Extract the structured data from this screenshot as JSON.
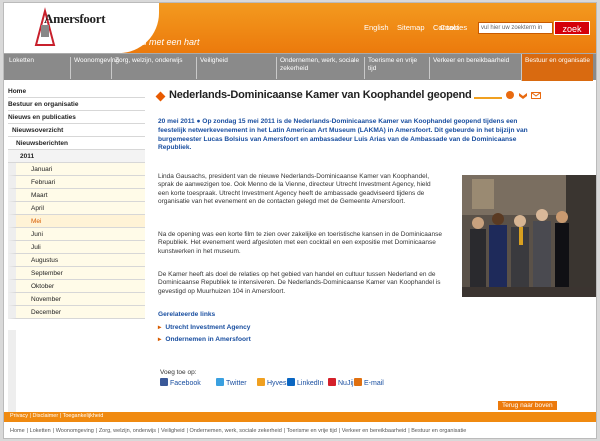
{
  "header": {
    "logo_text": "Amersfoort",
    "tagline": "Stad met een hart",
    "links": [
      "English",
      "Sitemap",
      "Contact",
      "Cookies"
    ],
    "search_placeholder": "vul hier uw zoekterm in",
    "search_button": "zoek"
  },
  "nav": [
    {
      "label": "Loketten"
    },
    {
      "label": "Woonomgeving"
    },
    {
      "label": "Zorg, welzijn, onderwijs"
    },
    {
      "label": "Veiligheid"
    },
    {
      "label": "Ondernemen, werk, sociale zekerheid"
    },
    {
      "label": "Toerisme en vrije tijd"
    },
    {
      "label": "Verkeer en bereikbaarheid"
    },
    {
      "label": "Bestuur en organisatie"
    }
  ],
  "sidebar": {
    "items": [
      "Home",
      "Bestuur en organisatie",
      "Nieuws en publicaties",
      "Nieuwsoverzicht",
      "Nieuwsberichten",
      "2011"
    ],
    "months": [
      "Januari",
      "Februari",
      "Maart",
      "April",
      "Mei",
      "Juni",
      "Juli",
      "Augustus",
      "September",
      "Oktober",
      "November",
      "December"
    ]
  },
  "article": {
    "title": "Nederlands-Dominicaanse Kamer van Koophandel geopend",
    "intro": "20 mei 2011  ●  Op zondag 15 mei 2011 is de Nederlands-Dominicaanse Kamer van Koophandel geopend tijdens een feestelijk netwerkevenement in het Latin American Art Museum (LAKMA) in Amersfoort. Dit gebeurde in het bijzijn van burgemeester Lucas Bolsius van Amersfoort en ambassadeur Luis Arias van de Ambassade van de Dominicaanse Republiek.",
    "p1": "Linda Gausachs, president van de nieuwe Nederlands-Dominicaanse Kamer van Koophandel, sprak de aanwezigen toe. Ook Menno de la Vienne, directeur Utrecht Investment Agency, hield een korte toespraak. Utrecht Investment Agency heeft de ambassade geadviseerd tijdens de organisatie van het evenement en de contacten gelegd met de Gemeente Amersfoort.",
    "p2": "Na de opening was een korte film te zien over zakelijke en toeristische kansen in de Dominicaanse Republiek. Het evenement werd afgesloten met een cocktail en een expositie met Dominicaanse kunstwerken in het museum.",
    "p3": "De Kamer heeft als doel de relaties op het gebied van handel en cultuur tussen Nederland en de Dominicaanse Republiek te intensiveren. De Nederlands-Dominicaanse Kamer van Koophandel is gevestigd op Muurhuizen 104 in Amersfoort.",
    "related_title": "Gerelateerde links",
    "related": [
      "Utrecht Investment Agency",
      "Ondernemen in Amersfoort"
    ],
    "share_label": "Voeg toe op:",
    "share": [
      "Facebook",
      "Twitter",
      "Hyves",
      "LinkedIn",
      "NuJij",
      "E-mail"
    ]
  },
  "footer": {
    "links": [
      "Privacy",
      "Disclaimer",
      "Toegankelijkheid"
    ],
    "back_to_top": "Terug naar boven",
    "nav": [
      "Home",
      "Loketten",
      "Woonomgeving",
      "Zorg, welzijn, onderwijs",
      "Veiligheid",
      "Ondernemen, werk, sociale zekerheid",
      "Toerisme en vrije tijd",
      "Verkeer en bereikbaarheid",
      "Bestuur en organisatie"
    ]
  },
  "colors": {
    "brand_orange": "#ec7a0c",
    "link_blue": "#1a4fa0",
    "zoek_red": "#d4000a"
  }
}
